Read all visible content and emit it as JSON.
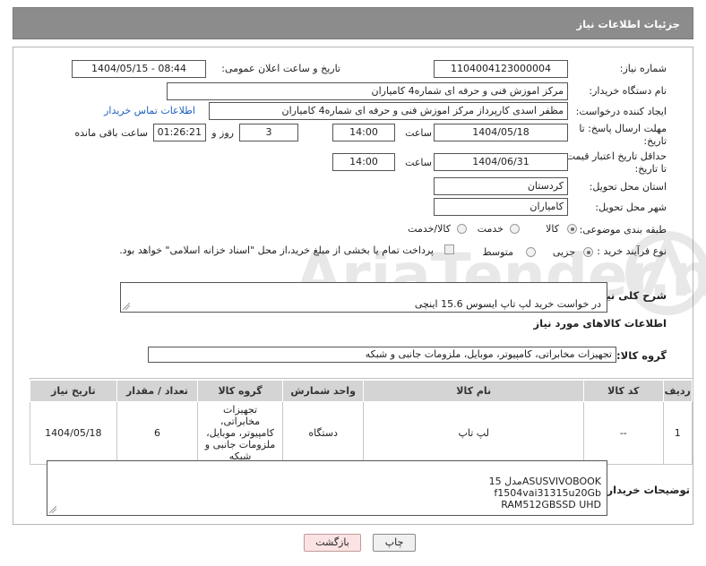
{
  "header": {
    "title": "جزئیات اطلاعات نیاز"
  },
  "form": {
    "need_number_label": "شماره نیاز:",
    "need_number": "1104004123000004",
    "announce_label": "تاریخ و ساعت اعلان عمومی:",
    "announce_value": "1404/05/15 - 08:44",
    "buyer_org_label": "نام دستگاه خریدار:",
    "buyer_org": "مرکز اموزش فنی و حرفه ای شماره4 کامیاران",
    "creator_label": "ایجاد کننده درخواست:",
    "creator": "مظفر اسدی کارپرداز مرکز اموزش فنی و حرفه ای شماره4 کامیاران",
    "contact_link": "اطلاعات تماس خریدار",
    "deadline_label_1": "مهلت ارسال پاسخ: تا",
    "deadline_label_2": "تاریخ:",
    "deadline_date": "1404/05/18",
    "time_label": "ساعت",
    "deadline_time": "14:00",
    "days_value": "3",
    "days_label": "روز و",
    "remaining_time": "01:26:21",
    "remaining_label": "ساعت باقی مانده",
    "validity_label_1": "حداقل تاریخ اعتبار قیمت:",
    "validity_label_2": "تا تاریخ:",
    "validity_date": "1404/06/31",
    "validity_time": "14:00",
    "province_label": "استان محل تحویل:",
    "province": "کردستان",
    "city_label": "شهر محل تحویل:",
    "city": "کامیاران",
    "category_label": "طبقه بندی موضوعی:",
    "category_options": [
      "کالا",
      "خدمت",
      "کالا/خدمت"
    ],
    "process_label": "نوع فرآیند خرید :",
    "process_options": [
      "جزیی",
      "متوسط"
    ],
    "payment_note": "پرداخت تمام یا بخشی از مبلغ خرید،از محل \"اسناد خزانه اسلامی\" خواهد بود.",
    "summary_label": "شرح کلی نیاز:",
    "summary": "در خواست خرید لپ تاپ ایسوس 15.6 اینچی",
    "goods_info_title": "اطلاعات کالاهای مورد نیاز",
    "goods_group_label": "گروه کالا:",
    "goods_group": "تجهیزات مخابراتی، کامپیوتر، موبایل، ملزومات جانبی و شبکه"
  },
  "table": {
    "headers": [
      "ردیف",
      "کد کالا",
      "نام کالا",
      "واحد شمارش",
      "گروه کالا",
      "تعداد / مقدار",
      "تاریخ نیاز"
    ],
    "rows": [
      {
        "row": "1",
        "code": "--",
        "name": "لپ تاپ",
        "unit": "دستگاه",
        "group": "تجهیزات مخابراتی، کامپیوتر، موبایل، ملزومات جانبی و شبکه",
        "qty": "6",
        "date": "1404/05/18"
      }
    ]
  },
  "buyer_notes_label": "توضیحات خریدار:",
  "buyer_notes": "مدل 15ASUSVIVOBOOK\nf1504vai31315u20Gb\nRAM512GBSSD UHD",
  "buttons": {
    "print": "چاپ",
    "back": "بازگشت"
  },
  "watermark": {
    "text": "AriaTender.net"
  }
}
